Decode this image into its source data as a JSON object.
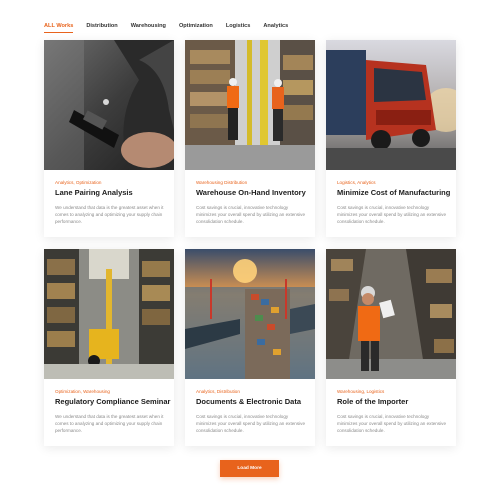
{
  "filters": {
    "items": [
      "ALL Works",
      "Distribution",
      "Warehousing",
      "Optimization",
      "Logistics",
      "Analytics"
    ],
    "active": "ALL Works"
  },
  "cards": [
    {
      "category": "Analytics, Optimization",
      "title": "Lane Pairing Analysis",
      "description": "We understand that data is the greatest asset when it comes to analyzing and optimizing your supply chain performance."
    },
    {
      "category": "Warehousing Distribution",
      "title": "Warehouse On-Hand Inventory",
      "description": "Cost savings is crucial, innovative technology minimizes your overall spend by utilizing an extensive consolidation schedule."
    },
    {
      "category": "Logistics, Analytics",
      "title": "Minimize Cost of Manufacturing",
      "description": "Cost savings is crucial, innovative technology minimizes your overall spend by utilizing an extensive consolidation schedule."
    },
    {
      "category": "Optimization, Warehousing",
      "title": "Regulatory Compliance Seminar",
      "description": "We understand that data is the greatest asset when it comes to analyzing and optimizing your supply chain performance."
    },
    {
      "category": "Analytics, Distribution",
      "title": "Documents & Electronic Data",
      "description": "Cost savings is crucial, innovative technology minimizes your overall spend by utilizing an extensive consolidation schedule."
    },
    {
      "category": "Warehousing, Logistics",
      "title": "Role of the Importer",
      "description": "Cost savings is crucial, innovative technology minimizes your overall spend by utilizing an extensive consolidation schedule."
    }
  ],
  "load_more": {
    "label": "Load More"
  },
  "colors": {
    "accent": "#e8631c",
    "title": "#1c1c1c",
    "text": "#8a8a8a"
  }
}
